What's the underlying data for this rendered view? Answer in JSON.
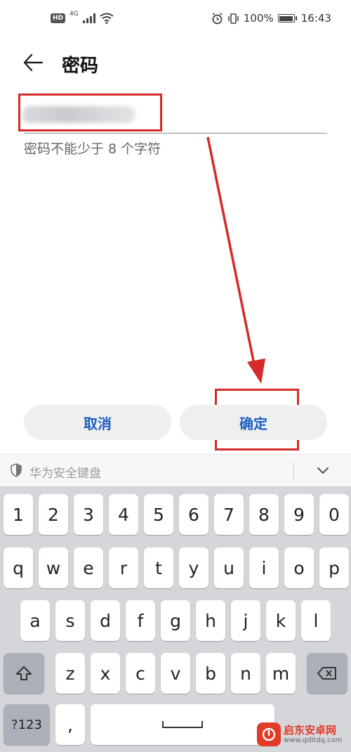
{
  "status_bar": {
    "hd": "HD",
    "network": "4G",
    "battery": "100%",
    "time": "16:43"
  },
  "header": {
    "title": "密码"
  },
  "password": {
    "value": "",
    "hint": "密码不能少于 8 个字符"
  },
  "actions": {
    "cancel_label": "取消",
    "confirm_label": "确定"
  },
  "keyboard": {
    "title": "华为安全键盘",
    "row_numbers": [
      "1",
      "2",
      "3",
      "4",
      "5",
      "6",
      "7",
      "8",
      "9",
      "0"
    ],
    "row1": [
      "q",
      "w",
      "e",
      "r",
      "t",
      "y",
      "u",
      "i",
      "o",
      "p"
    ],
    "row2": [
      "a",
      "s",
      "d",
      "f",
      "g",
      "h",
      "j",
      "k",
      "l"
    ],
    "row3": [
      "z",
      "x",
      "c",
      "v",
      "b",
      "n",
      "m"
    ],
    "mode_key": "?123",
    "comma": ","
  },
  "watermark": {
    "name": "启东安卓网",
    "url": "www.qdltdq.com"
  },
  "colors": {
    "accent": "#1d5fc2",
    "annotation": "#d42a2a"
  }
}
